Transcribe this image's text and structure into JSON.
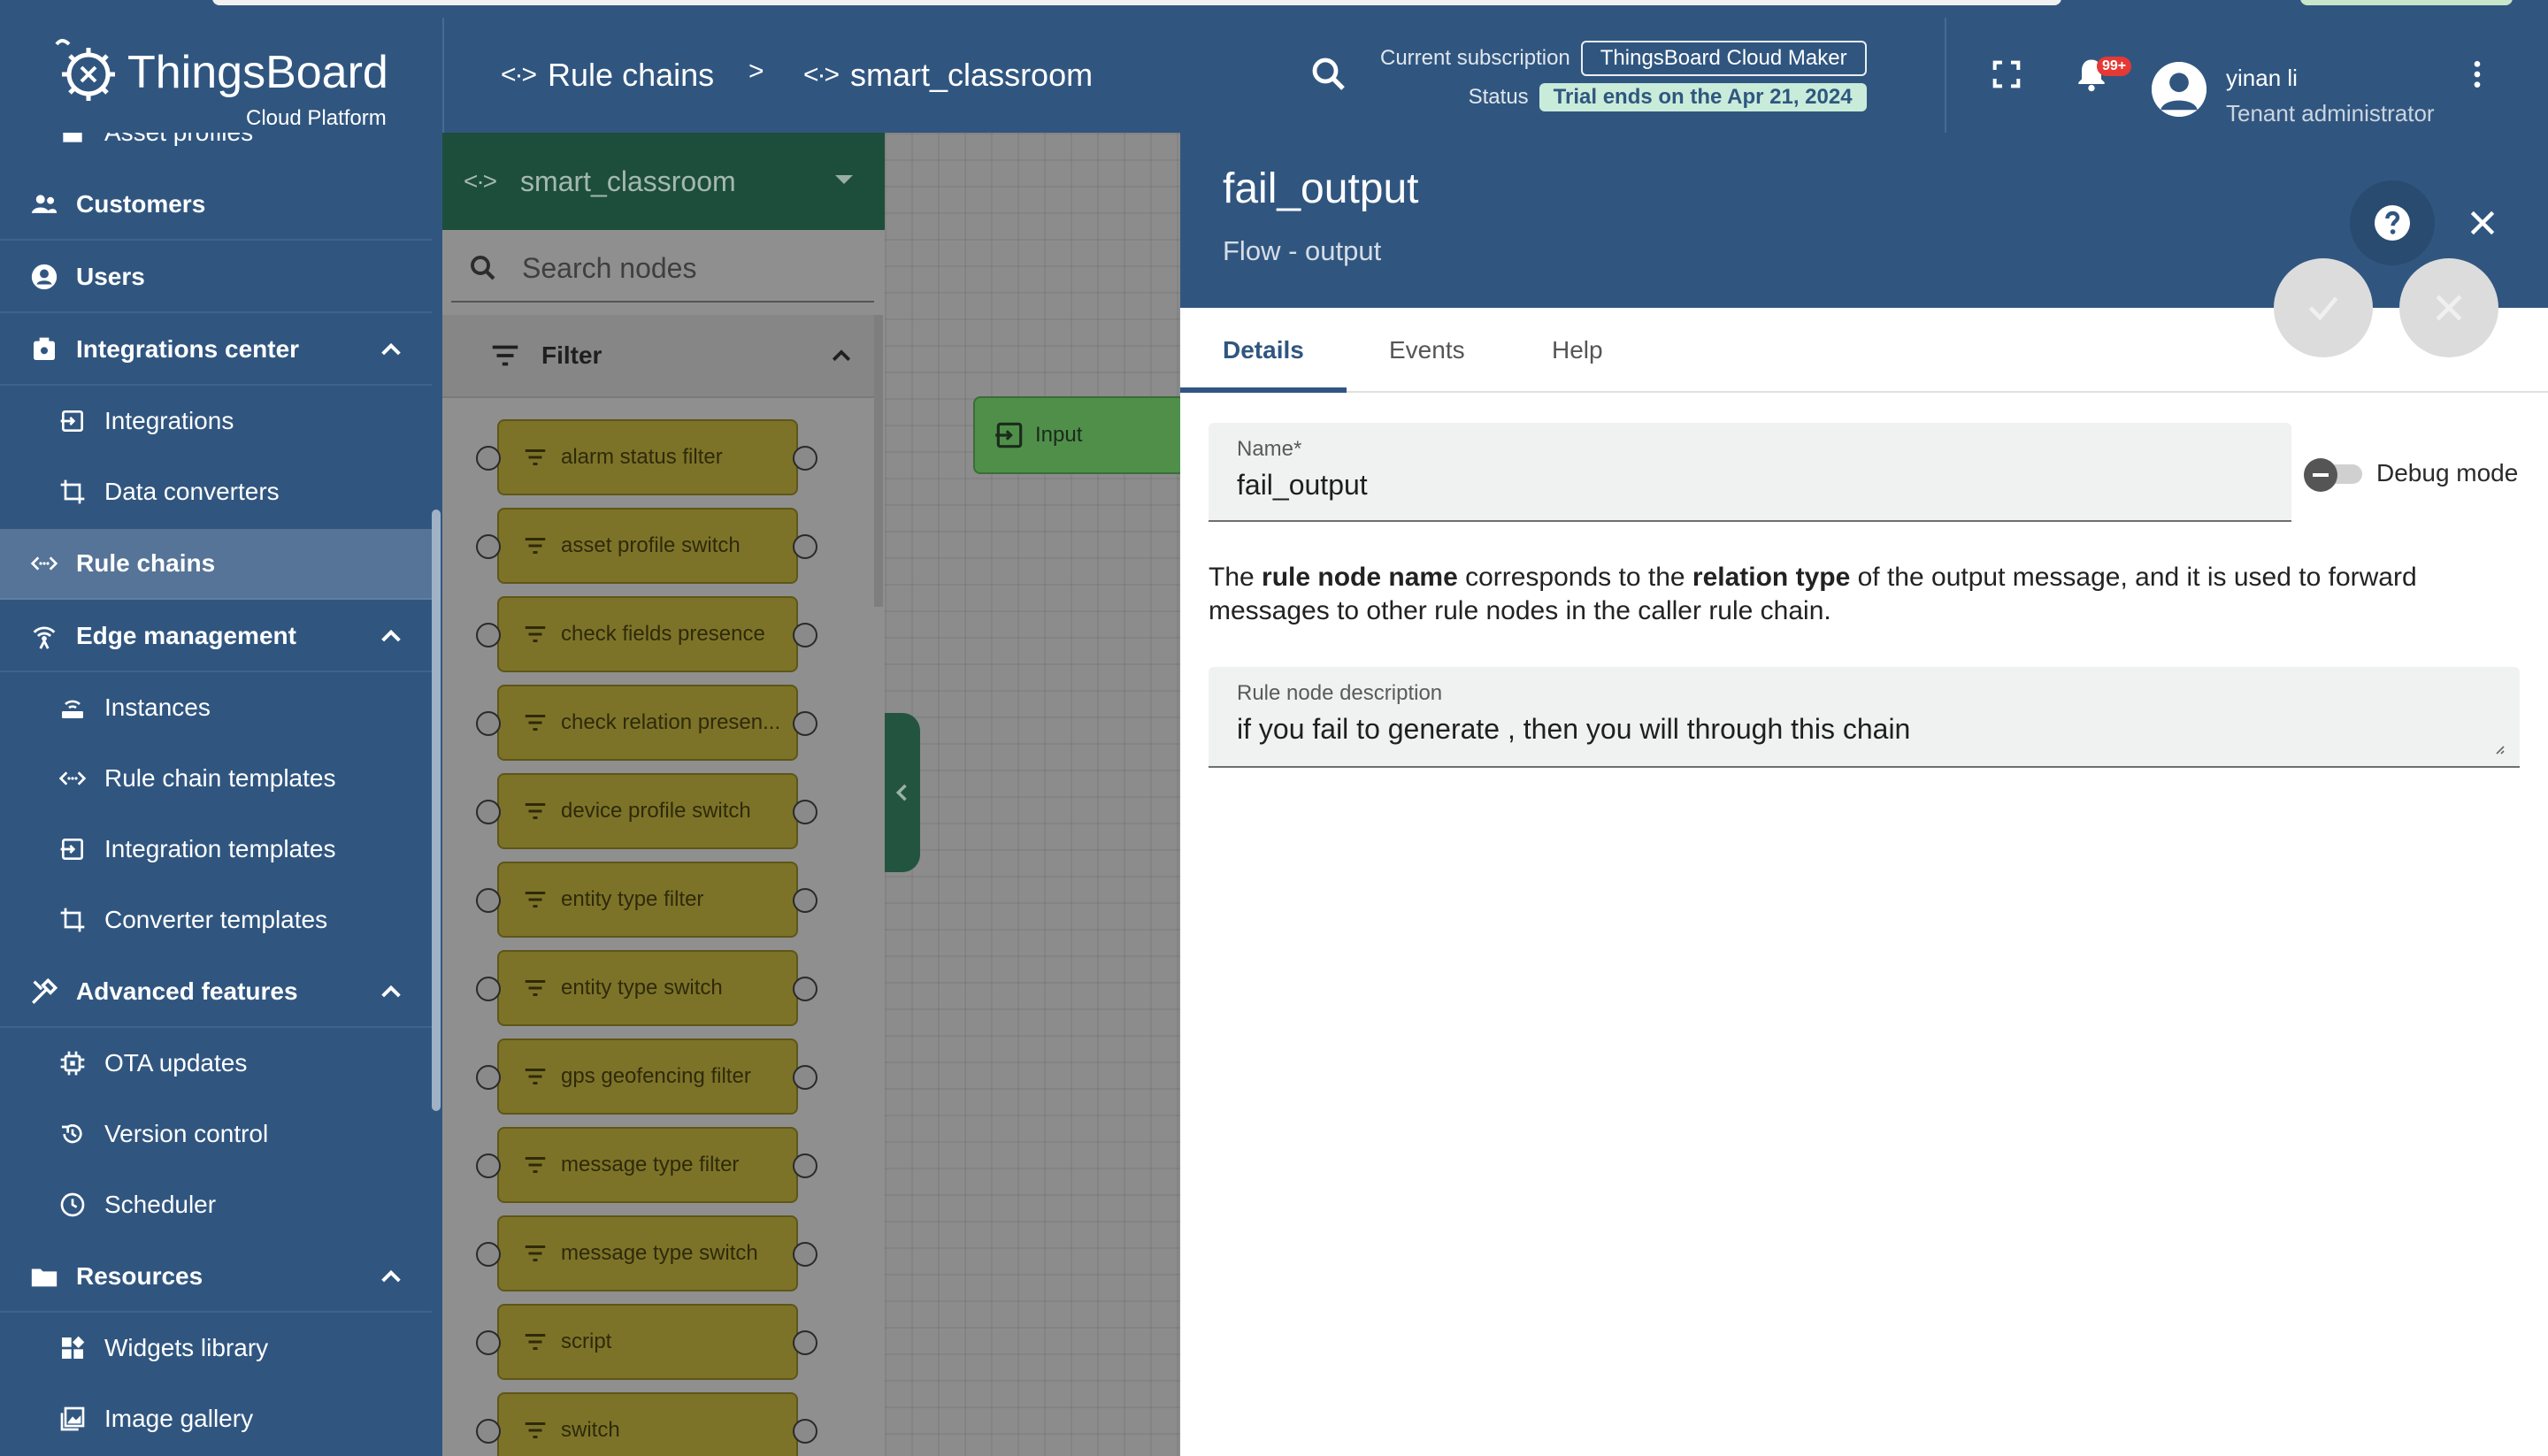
{
  "header": {
    "brand_name": "ThingsBoard",
    "brand_sub": "Cloud Platform",
    "crumb_1": "Rule chains",
    "crumb_sep": ">",
    "crumb_2": "smart_classroom",
    "code_glyph": "<·>",
    "subscription_label": "Current subscription",
    "subscription_value": "ThingsBoard Cloud Maker",
    "status_label": "Status",
    "status_value": "Trial ends on the Apr 21, 2024",
    "notif_count": "99+",
    "user_name": "yinan li",
    "user_role": "Tenant administrator"
  },
  "sidebar": {
    "partial_item": "Asset profiles",
    "customers": "Customers",
    "users": "Users",
    "integrations_center": "Integrations center",
    "integrations": "Integrations",
    "data_converters": "Data converters",
    "rule_chains": "Rule chains",
    "edge_management": "Edge management",
    "instances": "Instances",
    "rule_chain_templates": "Rule chain templates",
    "integration_templates": "Integration templates",
    "converter_templates": "Converter templates",
    "advanced_features": "Advanced features",
    "ota_updates": "OTA updates",
    "version_control": "Version control",
    "scheduler": "Scheduler",
    "resources": "Resources",
    "widgets_library": "Widgets library",
    "image_gallery": "Image gallery"
  },
  "node_panel": {
    "chain_select": "smart_classroom",
    "search_placeholder": "Search nodes",
    "filter_label": "Filter",
    "nodes": [
      "alarm status filter",
      "asset profile switch",
      "check fields presence",
      "check relation presen...",
      "device profile switch",
      "entity type filter",
      "entity type switch",
      "gps geofencing filter",
      "message type filter",
      "message type switch",
      "script",
      "switch"
    ]
  },
  "canvas": {
    "input_node": "Input"
  },
  "detail": {
    "title": "fail_output",
    "subtitle": "Flow - output",
    "tabs": [
      "Details",
      "Events",
      "Help"
    ],
    "name_label": "Name*",
    "name_value": "fail_output",
    "debug_label": "Debug mode",
    "desc_p1": "The ",
    "desc_b1": "rule node name",
    "desc_p2": " corresponds to the ",
    "desc_b2": "relation type",
    "desc_p3": " of the output message, and it is used to forward messages to other rule nodes in the caller rule chain.",
    "description_label": "Rule node description",
    "description_value": "if you fail to generate , then you will through this chain"
  },
  "colors": {
    "primary": "#305680",
    "node_filter": "#7d7328",
    "input_node": "#4f8f4a",
    "trial_chip": "#c8ecd9",
    "badge": "#e53935"
  }
}
